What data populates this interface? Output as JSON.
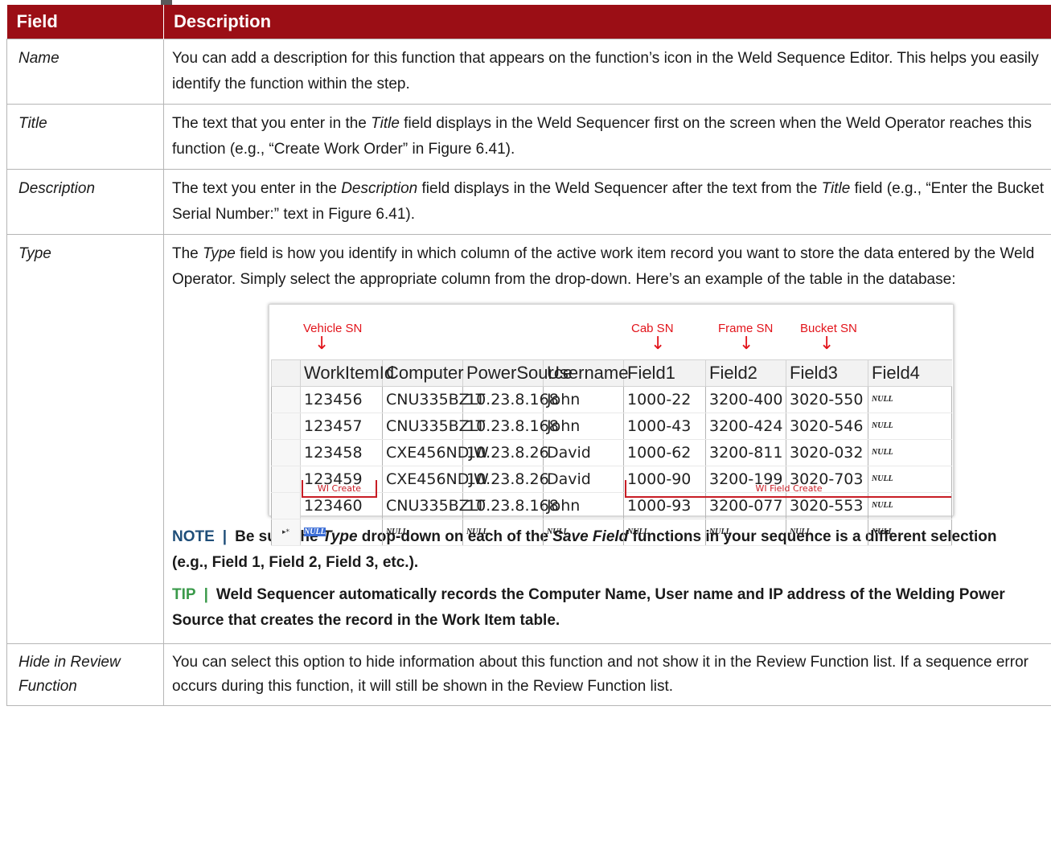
{
  "table": {
    "headers": {
      "field": "Field",
      "description": "Description"
    },
    "rows": {
      "name": {
        "field": "Name",
        "description": "You can add a description for this function that appears on the function’s icon in the Weld Sequence Editor.  This helps you easily identify the function within the step."
      },
      "title": {
        "field": "Title",
        "d1": "The text that you enter in the ",
        "d_it": "Title",
        "d2": " field displays in the Weld Sequencer first on the screen when the Weld Operator reaches this function (e.g., “Create Work Order” in Figure 6.41)."
      },
      "description": {
        "field": "Description",
        "d1": "The text you enter in the ",
        "d_it": "Description",
        "d2": " field displays in the Weld Sequencer after the text from the ",
        "d_it2": "Title",
        "d3": " field (e.g., “Enter the Bucket Serial Number:” text in Figure 6.41)."
      },
      "type": {
        "field": "Type",
        "d1": "The ",
        "d_it": "Type",
        "d2": " field is how you identify in which column of the active work item record you want to store the data entered by the Weld Operator.  Simply select the appropriate column from the drop-down.  Here’s an example of the table in the database:"
      },
      "hide": {
        "field": "Hide in Review Function",
        "description": "You can select this option to hide information about this function and not show it in the Review Function list.  If a sequence error occurs during this function, it will still be shown in the Review Function list."
      }
    }
  },
  "screenshot": {
    "annotations": {
      "vehicle_sn": "Vehicle SN",
      "cab_sn": "Cab SN",
      "frame_sn": "Frame SN",
      "bucket_sn": "Bucket SN",
      "arrow": "↓"
    },
    "columns": [
      "WorkItemId",
      "Computer",
      "PowerSource",
      "Username",
      "Field1",
      "Field2",
      "Field3",
      "Field4"
    ],
    "rows": [
      [
        "123456",
        "CNU335BZLT",
        "10.23.8.168",
        "John",
        "1000-22",
        "3200-400",
        "3020-550",
        "NULL"
      ],
      [
        "123457",
        "CNU335BZLT",
        "10.23.8.168",
        "John",
        "1000-43",
        "3200-424",
        "3020-546",
        "NULL"
      ],
      [
        "123458",
        "CXE456NDJW",
        "10.23.8.26",
        "David",
        "1000-62",
        "3200-811",
        "3020-032",
        "NULL"
      ],
      [
        "123459",
        "CXE456NDJW",
        "10.23.8.26",
        "David",
        "1000-90",
        "3200-199",
        "3020-703",
        "NULL"
      ],
      [
        "123460",
        "CNU335BZLT",
        "10.23.8.168",
        "John",
        "1000-93",
        "3200-077",
        "3020-553",
        "NULL"
      ]
    ],
    "new_row_marker": "▸*",
    "new_row": [
      "NULL",
      "NULL",
      "NULL",
      "NULL",
      "NULL",
      "NULL",
      "NULL",
      "NULL"
    ],
    "groups": {
      "wi_create": "WI Create",
      "wi_field_create": "WI Field Create"
    }
  },
  "note": {
    "tag": "NOTE",
    "sep": "|",
    "t1": "Be sure the ",
    "it1": "Type",
    "t2": " drop-down on each of the ",
    "it2": "Save Field",
    "t3": " functions in your sequence is a different selection (e.g., Field 1, Field 2, Field 3, etc.)."
  },
  "tip": {
    "tag": "TIP",
    "sep": "|",
    "text": "Weld Sequencer automatically records the Computer Name, User name and IP address of the Welding Power Source that creates the record in the Work Item table."
  },
  "colors": {
    "header_bg": "#9b0e15",
    "annotation_red": "#e2141b",
    "note_blue": "#1f4e79",
    "tip_green": "#3a9a4a"
  }
}
